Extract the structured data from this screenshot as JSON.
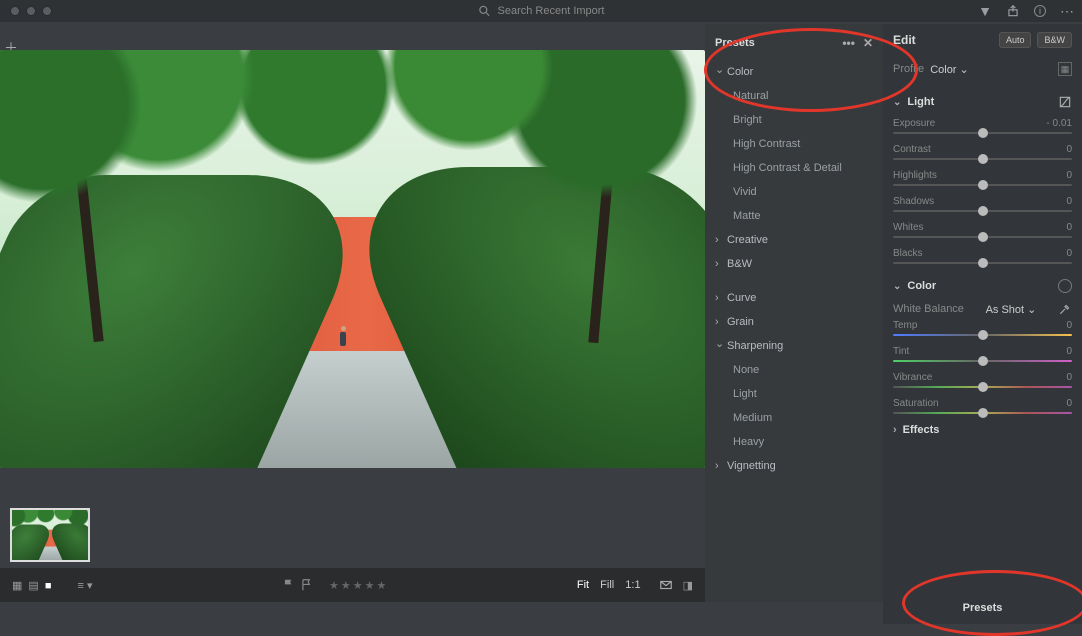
{
  "topbar": {
    "search_placeholder": "Search Recent Import",
    "icons": {
      "filter": "filter-icon",
      "share": "share-icon",
      "info": "info-icon",
      "menu": "ellipsis-icon"
    }
  },
  "presets": {
    "title": "Presets",
    "groups": [
      {
        "label": "Color",
        "open": true,
        "items": [
          "Natural",
          "Bright",
          "High Contrast",
          "High Contrast & Detail",
          "Vivid",
          "Matte"
        ]
      },
      {
        "label": "Creative",
        "open": false,
        "items": []
      },
      {
        "label": "B&W",
        "open": false,
        "items": []
      }
    ],
    "extras": [
      {
        "label": "Curve",
        "open": false,
        "items": []
      },
      {
        "label": "Grain",
        "open": false,
        "items": []
      },
      {
        "label": "Sharpening",
        "open": true,
        "items": [
          "None",
          "Light",
          "Medium",
          "Heavy"
        ]
      },
      {
        "label": "Vignetting",
        "open": false,
        "items": []
      }
    ]
  },
  "edit": {
    "title": "Edit",
    "auto_btn": "Auto",
    "bw_btn": "B&W",
    "profile_label": "Profile",
    "profile_value": "Color",
    "light": {
      "title": "Light",
      "sliders": [
        {
          "name": "Exposure",
          "value": "- 0.01",
          "pos": 50
        },
        {
          "name": "Contrast",
          "value": "0",
          "pos": 50
        },
        {
          "name": "Highlights",
          "value": "0",
          "pos": 50
        },
        {
          "name": "Shadows",
          "value": "0",
          "pos": 50
        },
        {
          "name": "Whites",
          "value": "0",
          "pos": 50
        },
        {
          "name": "Blacks",
          "value": "0",
          "pos": 50
        }
      ]
    },
    "color": {
      "title": "Color",
      "wb_label": "White Balance",
      "wb_value": "As Shot",
      "sliders": [
        {
          "name": "Temp",
          "value": "0",
          "pos": 50,
          "grad": "grad-temp"
        },
        {
          "name": "Tint",
          "value": "0",
          "pos": 50,
          "grad": "grad-tint"
        },
        {
          "name": "Vibrance",
          "value": "0",
          "pos": 50,
          "grad": "grad-vib"
        },
        {
          "name": "Saturation",
          "value": "0",
          "pos": 50,
          "grad": "grad-sat"
        }
      ]
    },
    "effects": {
      "title": "Effects"
    },
    "bottom_presets": "Presets"
  },
  "footer": {
    "fit": "Fit",
    "fill": "Fill",
    "one_to_one": "1:1"
  }
}
